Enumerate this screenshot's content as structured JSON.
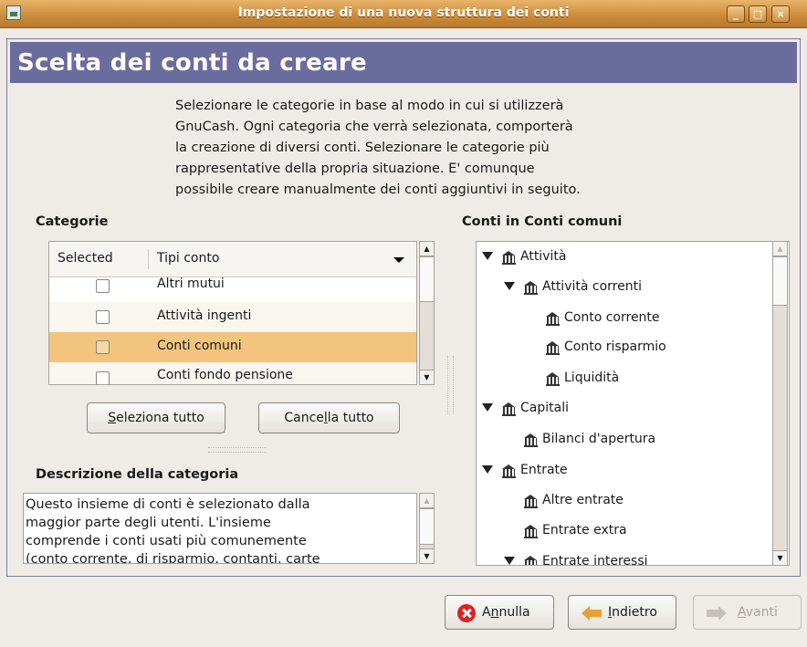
{
  "window": {
    "title": "Impostazione di una nuova struttura dei conti",
    "controls": {
      "minimize": "_",
      "maximize": "□",
      "close": "×"
    }
  },
  "header": {
    "title": "Scelta dei conti da creare"
  },
  "intro": {
    "lines": [
      "Selezionare le categorie in base al modo in cui si utilizzerà",
      "GnuCash. Ogni categoria che verrà selezionata, comporterà",
      "la creazione di diversi conti. Selezionare le categorie più",
      "rappresentative della propria situazione. E' comunque",
      "possibile creare manualmente dei conti aggiuntivi in seguito."
    ]
  },
  "categories": {
    "heading": "Categorie",
    "columns": {
      "selected": "Selected",
      "type": "Tipi conto"
    },
    "rows": [
      {
        "label": "Altri mutui",
        "checked": false,
        "selected": false
      },
      {
        "label": "Attività ingenti",
        "checked": false,
        "selected": false
      },
      {
        "label": "Conti comuni",
        "checked": false,
        "selected": true
      },
      {
        "label": "Conti fondo pensione",
        "checked": false,
        "selected": false
      }
    ],
    "select_all": {
      "pre": "",
      "mnemonic": "S",
      "post": "eleziona tutto"
    },
    "clear_all": {
      "pre": "Cance",
      "mnemonic": "l",
      "post": "la tutto"
    }
  },
  "description": {
    "heading": "Descrizione della categoria",
    "lines": [
      "Questo insieme di conti è selezionato dalla",
      "maggior parte degli utenti. L'insieme",
      "comprende i conti usati più comunemente",
      "(conto corrente, di risparmio, contanti, carte"
    ]
  },
  "accounts": {
    "heading": "Conti in Conti comuni",
    "items": [
      {
        "label": "Attività",
        "level": 0,
        "expander": true
      },
      {
        "label": "Attività correnti",
        "level": 1,
        "expander": true
      },
      {
        "label": "Conto corrente",
        "level": 2,
        "expander": false
      },
      {
        "label": "Conto risparmio",
        "level": 2,
        "expander": false
      },
      {
        "label": "Liquidità",
        "level": 2,
        "expander": false
      },
      {
        "label": "Capitali",
        "level": 0,
        "expander": true
      },
      {
        "label": "Bilanci d'apertura",
        "level": 1,
        "expander": false
      },
      {
        "label": "Entrate",
        "level": 0,
        "expander": true
      },
      {
        "label": "Altre entrate",
        "level": 1,
        "expander": false
      },
      {
        "label": "Entrate extra",
        "level": 1,
        "expander": false
      },
      {
        "label": "Entrate interessi",
        "level": 1,
        "expander": true
      }
    ]
  },
  "footer": {
    "cancel": {
      "pre": "A",
      "mnemonic": "n",
      "post": "nulla"
    },
    "back": {
      "pre": "",
      "mnemonic": "I",
      "post": "ndietro"
    },
    "forward": {
      "pre": "",
      "mnemonic": "A",
      "post": "vanti",
      "enabled": false
    }
  },
  "icons": {
    "app": "gnucash-app-icon",
    "account": "bank-icon",
    "cancel": "cancel-icon",
    "back": "back-arrow-icon",
    "forward": "forward-arrow-icon"
  },
  "colors": {
    "titlebar": "#c98a3a",
    "header_bg": "#6b6c9e",
    "selection": "#f2c47e",
    "window_bg": "#efebe7"
  }
}
